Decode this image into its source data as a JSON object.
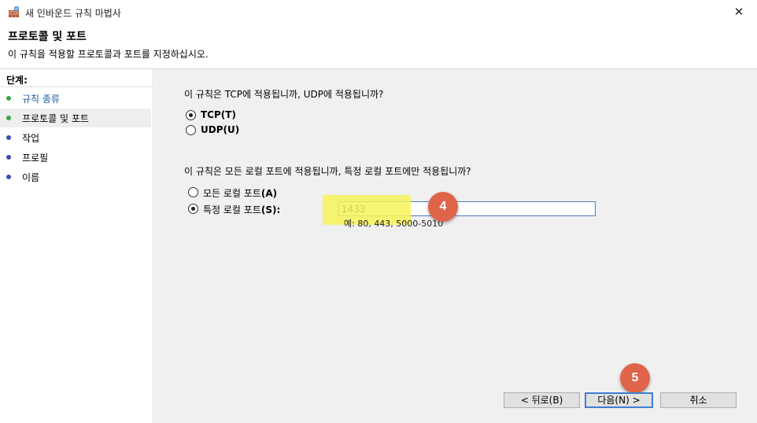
{
  "window": {
    "title": "새 인바운드 규칙 마법사",
    "close_glyph": "✕"
  },
  "header": {
    "title": "프로토콜 및 포트",
    "subtitle": "이 규칙을 적용할 프로토콜과 포트를 지정하십시오."
  },
  "steps": {
    "title": "단계:",
    "items": [
      {
        "label": "규칙 종류",
        "state": "done"
      },
      {
        "label": "프로토콜 및 포트",
        "state": "current"
      },
      {
        "label": "작업",
        "state": "pending"
      },
      {
        "label": "프로필",
        "state": "pending"
      },
      {
        "label": "이름",
        "state": "pending"
      }
    ]
  },
  "protocol": {
    "question": "이 규칙은 TCP에 적용됩니까, UDP에 적용됩니까?",
    "options": [
      {
        "label": "TCP(T)",
        "checked": true
      },
      {
        "label": "UDP(U)",
        "checked": false
      }
    ]
  },
  "ports": {
    "question": "이 규칙은 모든 로컬 포트에 적용됩니까, 특정 로컬 포트에만 적용됩니까?",
    "options": [
      {
        "label_prefix": "모든 로컬 포트",
        "label_suffix": "(A)",
        "checked": false
      },
      {
        "label_prefix": "특정 로컬 포트",
        "label_suffix": "(S):",
        "checked": true
      }
    ],
    "value": "1433",
    "example": "예: 80, 443, 5000-5010"
  },
  "annotations": {
    "badge4": "4",
    "badge5": "5"
  },
  "buttons": {
    "back": "< 뒤로(B)",
    "next": "다음(N) >",
    "cancel": "취소"
  },
  "colors": {
    "done_dot": "#3aa641",
    "pending_dot": "#3f49b4",
    "badge": "#e0644a",
    "highlight": "#f7f35a",
    "accent": "#3c7fd1"
  }
}
